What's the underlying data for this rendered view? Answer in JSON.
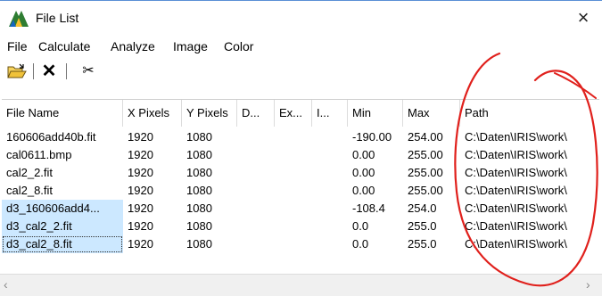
{
  "window": {
    "title": "File List",
    "close_glyph": "×"
  },
  "menu": [
    "File",
    "Calculate",
    "Analyze",
    "Image",
    "Color"
  ],
  "toolbar": {
    "cut_glyph": "✂",
    "delete_glyph": "✕"
  },
  "columns": [
    "File Name",
    "X Pixels",
    "Y Pixels",
    "D...",
    "Ex...",
    "I...",
    "Min",
    "Max",
    "Path"
  ],
  "rows": [
    {
      "name": "160606add40b.fit",
      "x": "1920",
      "y": "1080",
      "min": "-190.00",
      "max": "254.00",
      "path": "C:\\Daten\\IRIS\\work\\"
    },
    {
      "name": "cal0611.bmp",
      "x": "1920",
      "y": "1080",
      "min": "0.00",
      "max": "255.00",
      "path": "C:\\Daten\\IRIS\\work\\"
    },
    {
      "name": "cal2_2.fit",
      "x": "1920",
      "y": "1080",
      "min": "0.00",
      "max": "255.00",
      "path": "C:\\Daten\\IRIS\\work\\"
    },
    {
      "name": "cal2_8.fit",
      "x": "1920",
      "y": "1080",
      "min": "0.00",
      "max": "255.00",
      "path": "C:\\Daten\\IRIS\\work\\"
    },
    {
      "name": "d3_160606add4...",
      "x": "1920",
      "y": "1080",
      "min": "-108.4",
      "max": "254.0",
      "path": "C:\\Daten\\IRIS\\work\\"
    },
    {
      "name": "d3_cal2_2.fit",
      "x": "1920",
      "y": "1080",
      "min": "0.0",
      "max": "255.0",
      "path": "C:\\Daten\\IRIS\\work\\"
    },
    {
      "name": "d3_cal2_8.fit",
      "x": "1920",
      "y": "1080",
      "min": "0.0",
      "max": "255.0",
      "path": "C:\\Daten\\IRIS\\work\\"
    }
  ],
  "selected_rows": [
    4,
    5,
    6
  ],
  "focused_row": 6,
  "scroll": {
    "left_glyph": "‹",
    "right_glyph": "›"
  },
  "colors": {
    "selection": "#cce8ff",
    "annotation": "#e0201c",
    "title_border": "#5a8fd6"
  }
}
